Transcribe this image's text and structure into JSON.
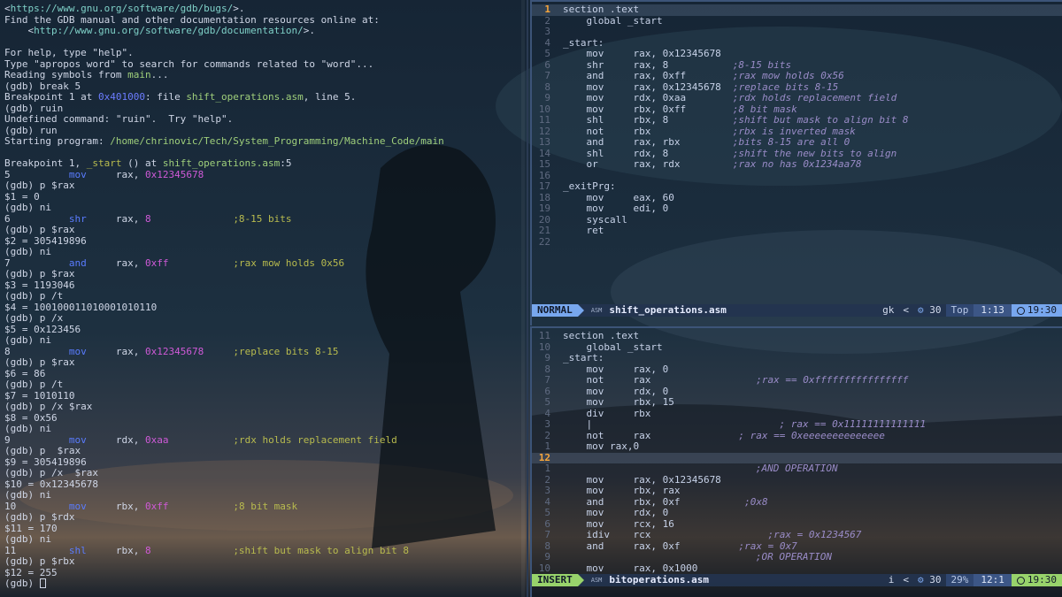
{
  "gdb": {
    "lines": [
      [
        {
          "t": "<"
        },
        {
          "t": "https://www.gnu.org/software/gdb/bugs/",
          "c": "link"
        },
        {
          "t": ">."
        }
      ],
      [
        {
          "t": "Find the GDB manual and other documentation resources online at:"
        }
      ],
      [
        {
          "t": "    <"
        },
        {
          "t": "http://www.gnu.org/software/gdb/documentation/",
          "c": "link"
        },
        {
          "t": ">."
        }
      ],
      [
        {
          "t": ""
        }
      ],
      [
        {
          "t": "For help, type \"help\"."
        }
      ],
      [
        {
          "t": "Type \"apropos word\" to search for commands related to \"word\"..."
        }
      ],
      [
        {
          "t": "Reading symbols from "
        },
        {
          "t": "main",
          "c": "file"
        },
        {
          "t": "..."
        }
      ],
      [
        {
          "t": "(gdb) break 5"
        }
      ],
      [
        {
          "t": "Breakpoint 1 at "
        },
        {
          "t": "0x401000",
          "c": "addr"
        },
        {
          "t": ": file "
        },
        {
          "t": "shift_operations.asm",
          "c": "file"
        },
        {
          "t": ", line 5."
        }
      ],
      [
        {
          "t": "(gdb) ruin"
        }
      ],
      [
        {
          "t": "Undefined command: \"ruin\".  Try \"help\"."
        }
      ],
      [
        {
          "t": "(gdb) run"
        }
      ],
      [
        {
          "t": "Starting program: "
        },
        {
          "t": "/home/chrinovic/Tech/System_Programming/Machine_Code/main",
          "c": "path"
        }
      ],
      [
        {
          "t": ""
        }
      ],
      [
        {
          "t": "Breakpoint 1, "
        },
        {
          "t": "_start",
          "c": "cm"
        },
        {
          "t": " () at "
        },
        {
          "t": "shift_operations.asm",
          "c": "file"
        },
        {
          "t": ":5"
        }
      ],
      [
        {
          "t": "5          "
        },
        {
          "t": "mov",
          "c": "kw"
        },
        {
          "t": "     rax, "
        },
        {
          "t": "0x12345678",
          "c": "num"
        }
      ],
      [
        {
          "t": "(gdb) p $rax"
        }
      ],
      [
        {
          "t": "$1 = 0"
        }
      ],
      [
        {
          "t": "(gdb) ni"
        }
      ],
      [
        {
          "t": "6          "
        },
        {
          "t": "shr",
          "c": "kw"
        },
        {
          "t": "     rax, "
        },
        {
          "t": "8",
          "c": "num"
        },
        {
          "t": "              "
        },
        {
          "t": ";8-15 bits",
          "c": "cm"
        }
      ],
      [
        {
          "t": "(gdb) p $rax"
        }
      ],
      [
        {
          "t": "$2 = 305419896"
        }
      ],
      [
        {
          "t": "(gdb) ni"
        }
      ],
      [
        {
          "t": "7          "
        },
        {
          "t": "and",
          "c": "kw"
        },
        {
          "t": "     rax, "
        },
        {
          "t": "0xff",
          "c": "num"
        },
        {
          "t": "           "
        },
        {
          "t": ";rax mow holds 0x56",
          "c": "cm"
        }
      ],
      [
        {
          "t": "(gdb) p $rax"
        }
      ],
      [
        {
          "t": "$3 = 1193046"
        }
      ],
      [
        {
          "t": "(gdb) p /t"
        }
      ],
      [
        {
          "t": "$4 = 100100011010001010110"
        }
      ],
      [
        {
          "t": "(gdb) p /x"
        }
      ],
      [
        {
          "t": "$5 = 0x123456"
        }
      ],
      [
        {
          "t": "(gdb) ni"
        }
      ],
      [
        {
          "t": "8          "
        },
        {
          "t": "mov",
          "c": "kw"
        },
        {
          "t": "     rax, "
        },
        {
          "t": "0x12345678",
          "c": "num"
        },
        {
          "t": "     "
        },
        {
          "t": ";replace bits 8-15",
          "c": "cm"
        }
      ],
      [
        {
          "t": "(gdb) p $rax"
        }
      ],
      [
        {
          "t": "$6 = 86"
        }
      ],
      [
        {
          "t": "(gdb) p /t"
        }
      ],
      [
        {
          "t": "$7 = 1010110"
        }
      ],
      [
        {
          "t": "(gdb) p /x $rax"
        }
      ],
      [
        {
          "t": "$8 = 0x56"
        }
      ],
      [
        {
          "t": "(gdb) ni"
        }
      ],
      [
        {
          "t": "9          "
        },
        {
          "t": "mov",
          "c": "kw"
        },
        {
          "t": "     rdx, "
        },
        {
          "t": "0xaa",
          "c": "num"
        },
        {
          "t": "           "
        },
        {
          "t": ";rdx holds replacement field",
          "c": "cm"
        }
      ],
      [
        {
          "t": "(gdb) p  $rax"
        }
      ],
      [
        {
          "t": "$9 = 305419896"
        }
      ],
      [
        {
          "t": "(gdb) p /x  $rax"
        }
      ],
      [
        {
          "t": "$10 = 0x12345678"
        }
      ],
      [
        {
          "t": "(gdb) ni"
        }
      ],
      [
        {
          "t": "10         "
        },
        {
          "t": "mov",
          "c": "kw"
        },
        {
          "t": "     rbx, "
        },
        {
          "t": "0xff",
          "c": "num"
        },
        {
          "t": "           "
        },
        {
          "t": ";8 bit mask",
          "c": "cm"
        }
      ],
      [
        {
          "t": "(gdb) p $rdx"
        }
      ],
      [
        {
          "t": "$11 = 170"
        }
      ],
      [
        {
          "t": "(gdb) ni"
        }
      ],
      [
        {
          "t": "11         "
        },
        {
          "t": "shl",
          "c": "kw"
        },
        {
          "t": "     rbx, "
        },
        {
          "t": "8",
          "c": "num"
        },
        {
          "t": "              "
        },
        {
          "t": ";shift but mask to align bit 8",
          "c": "cm"
        }
      ],
      [
        {
          "t": "(gdb) p $rbx"
        }
      ],
      [
        {
          "t": "$12 = 255"
        }
      ],
      [
        {
          "t": "(gdb) "
        },
        {
          "t": "",
          "c": "cursor"
        }
      ]
    ]
  },
  "top_editor": {
    "lines": [
      {
        "n": "1",
        "cur": true,
        "code": "section .text"
      },
      {
        "n": "2",
        "code": "    global _start"
      },
      {
        "n": "3",
        "code": ""
      },
      {
        "n": "4",
        "code": "_start:"
      },
      {
        "n": "5",
        "code": "    mov     rax, 0x12345678"
      },
      {
        "n": "6",
        "code": "    shr     rax, 8",
        "cm": ";8-15 bits"
      },
      {
        "n": "7",
        "code": "    and     rax, 0xff",
        "cm": ";rax mow holds 0x56"
      },
      {
        "n": "8",
        "code": "    mov     rax, 0x12345678",
        "cm": ";replace bits 8-15"
      },
      {
        "n": "9",
        "code": "    mov     rdx, 0xaa",
        "cm": ";rdx holds replacement field"
      },
      {
        "n": "10",
        "code": "    mov     rbx, 0xff",
        "cm": ";8 bit mask"
      },
      {
        "n": "11",
        "code": "    shl     rbx, 8",
        "cm": ";shift but mask to align bit 8"
      },
      {
        "n": "12",
        "code": "    not     rbx",
        "cm": ";rbx is inverted mask"
      },
      {
        "n": "13",
        "code": "    and     rax, rbx",
        "cm": ";bits 8-15 are all 0"
      },
      {
        "n": "14",
        "code": "    shl     rdx, 8",
        "cm": ";shift the new bits to align"
      },
      {
        "n": "15",
        "code": "    or      rax, rdx",
        "cm": ";rax no has 0x1234aa78"
      },
      {
        "n": "16",
        "code": ""
      },
      {
        "n": "17",
        "code": "_exitPrg:"
      },
      {
        "n": "18",
        "code": "    mov     eax, 60"
      },
      {
        "n": "19",
        "code": "    mov     edi, 0"
      },
      {
        "n": "20",
        "code": "    syscall"
      },
      {
        "n": "21",
        "code": "    ret"
      },
      {
        "n": "22",
        "code": ""
      }
    ],
    "status": {
      "mode": "NORMAL",
      "filetype": "ASM",
      "filename": "shift_operations.asm",
      "branch": "gk",
      "icon_count": "30",
      "percent": "Top",
      "position": "1:13",
      "time": "19:30"
    }
  },
  "bottom_editor": {
    "lines": [
      {
        "n": "11",
        "code": "section .text"
      },
      {
        "n": "10",
        "code": "    global _start"
      },
      {
        "n": "9",
        "code": "_start:"
      },
      {
        "n": "8",
        "code": "    mov     rax, 0"
      },
      {
        "n": "7",
        "code": "    not     rax",
        "cm": "    ;rax == 0xffffffffffffffff"
      },
      {
        "n": "6",
        "code": "    mov     rdx, 0"
      },
      {
        "n": "5",
        "code": "    mov     rbx, 15"
      },
      {
        "n": "4",
        "code": "    div     rbx"
      },
      {
        "n": "3",
        "code": "    |",
        "cm": "        ; rax == 0x11111111111111"
      },
      {
        "n": "2",
        "code": "    not     rax",
        "cm": " ; rax == 0xeeeeeeeeeeeeee"
      },
      {
        "n": "1",
        "code": "    mov rax,0"
      },
      {
        "n": "12",
        "cur": true,
        "code": ""
      },
      {
        "n": "1",
        "code": "",
        "cm": "    ;AND OPERATION"
      },
      {
        "n": "2",
        "code": "    mov     rax, 0x12345678"
      },
      {
        "n": "3",
        "code": "    mov     rbx, rax"
      },
      {
        "n": "4",
        "code": "    and     rbx, 0xf",
        "cm": "  ;0x8"
      },
      {
        "n": "5",
        "code": "    mov     rdx, 0"
      },
      {
        "n": "6",
        "code": "    mov     rcx, 16"
      },
      {
        "n": "7",
        "code": "    idiv    rcx",
        "cm": "      ;rax = 0x1234567"
      },
      {
        "n": "8",
        "code": "    and     rax, 0xf",
        "cm": " ;rax = 0x7"
      },
      {
        "n": "9",
        "code": "",
        "cm": "    ;OR OPERATION"
      },
      {
        "n": "10",
        "code": "    mov     rax, 0x1000"
      }
    ],
    "status": {
      "mode": "INSERT",
      "filetype": "ASM",
      "filename": "bitoperations.asm",
      "branch": "i",
      "icon_count": "30",
      "percent": "29%",
      "position": "12:1",
      "time": "19:30"
    }
  }
}
